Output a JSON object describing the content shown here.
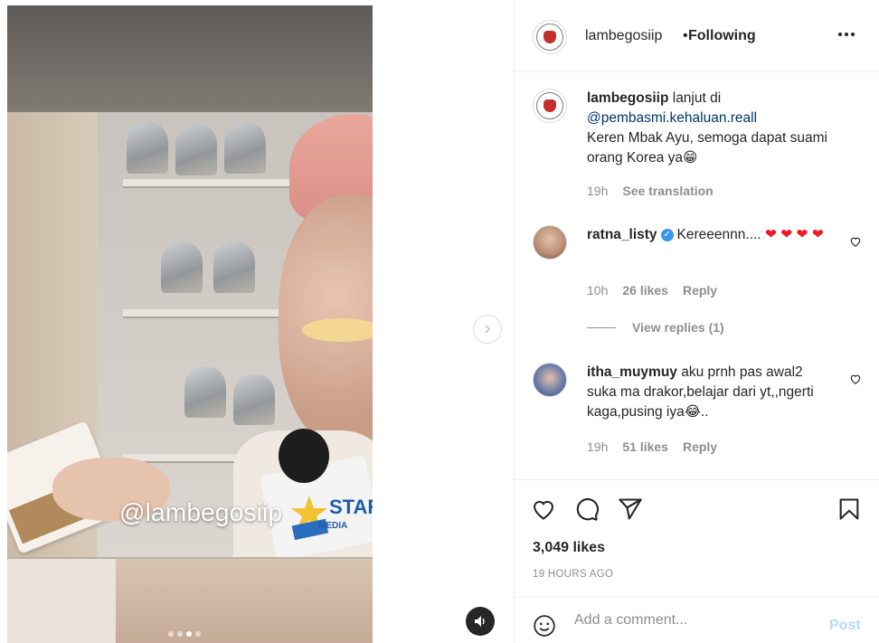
{
  "media": {
    "watermark": "@lambegosiip",
    "overlay_logo": "STAR",
    "overlay_logo_sub": "MEDIA",
    "carousel_count": 4,
    "carousel_active": 3
  },
  "header": {
    "username": "lambegosiip",
    "separator": "•",
    "follow_status": "Following",
    "more_icon": "more-horizontal-icon"
  },
  "caption": {
    "username": "lambegosiip",
    "text_before": " lanjut di",
    "mention": "@pembasmi.kehaluan.reall",
    "text_after": "Keren Mbak Ayu, semoga dapat suami orang Korea ya😁",
    "time": "19h",
    "translate": "See translation"
  },
  "comments": [
    {
      "username": "ratna_listy",
      "verified": true,
      "text": "Kereeennn....",
      "hearts": "❤ ❤ ❤ ❤",
      "time": "10h",
      "likes": "26 likes",
      "reply": "Reply",
      "view_replies": "View replies (1)"
    },
    {
      "username": "itha_muymuy",
      "verified": false,
      "text": "aku prnh pas awal2 suka ma drakor,belajar dari yt,,ngerti kaga,pusing iya😂..",
      "time": "19h",
      "likes": "51 likes",
      "reply": "Reply"
    }
  ],
  "actions": {
    "likes": "3,049 likes",
    "timestamp": "19 HOURS AGO"
  },
  "add_comment": {
    "placeholder": "Add a comment...",
    "post": "Post"
  },
  "colors": {
    "link": "#00376b",
    "muted": "#8e8e8e",
    "post_disabled": "#b2dffc",
    "verified": "#3897f0",
    "heart": "#ed1c24"
  }
}
